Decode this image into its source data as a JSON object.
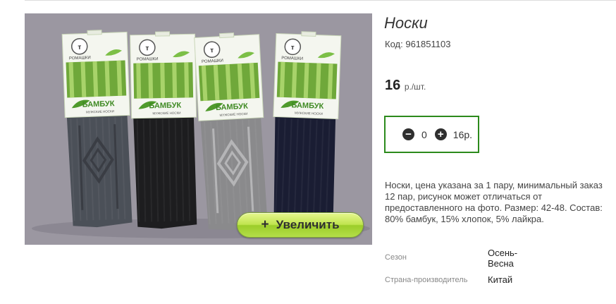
{
  "product": {
    "title": "Носки",
    "code_label": "Код:",
    "code": "961851103",
    "price": "16",
    "price_unit": "р./шт.",
    "zoom_label": "Увеличить",
    "zoom_icon": "+",
    "description": "Носки, цена указана за 1 пару, минимальный заказ 12 пар, рисунок может отличаться от предоставленного на фото. Размер: 42-48. Состав: 80% бамбук, 15% хлопок, 5% лайкра."
  },
  "image": {
    "brand": "РОМАШКИ",
    "label_text": "БАМБУК",
    "sub_text": "МУЖСКИЕ НОСКИ",
    "sock_colors": [
      "#4b5058",
      "#1d1d1f",
      "#8a8a8c",
      "#1a1d33"
    ]
  },
  "quantity": {
    "minus_icon": "−",
    "plus_icon": "+",
    "value": "0",
    "total": "16р."
  },
  "properties": [
    {
      "label": "Сезон",
      "value_line1": "Осень-",
      "value_line2": "Весна"
    },
    {
      "label": "Страна-производитель",
      "value_line1": "Китай",
      "value_line2": ""
    }
  ],
  "colors": {
    "accent_green": "#2c8a1c",
    "button_green": "#b3dd48"
  }
}
